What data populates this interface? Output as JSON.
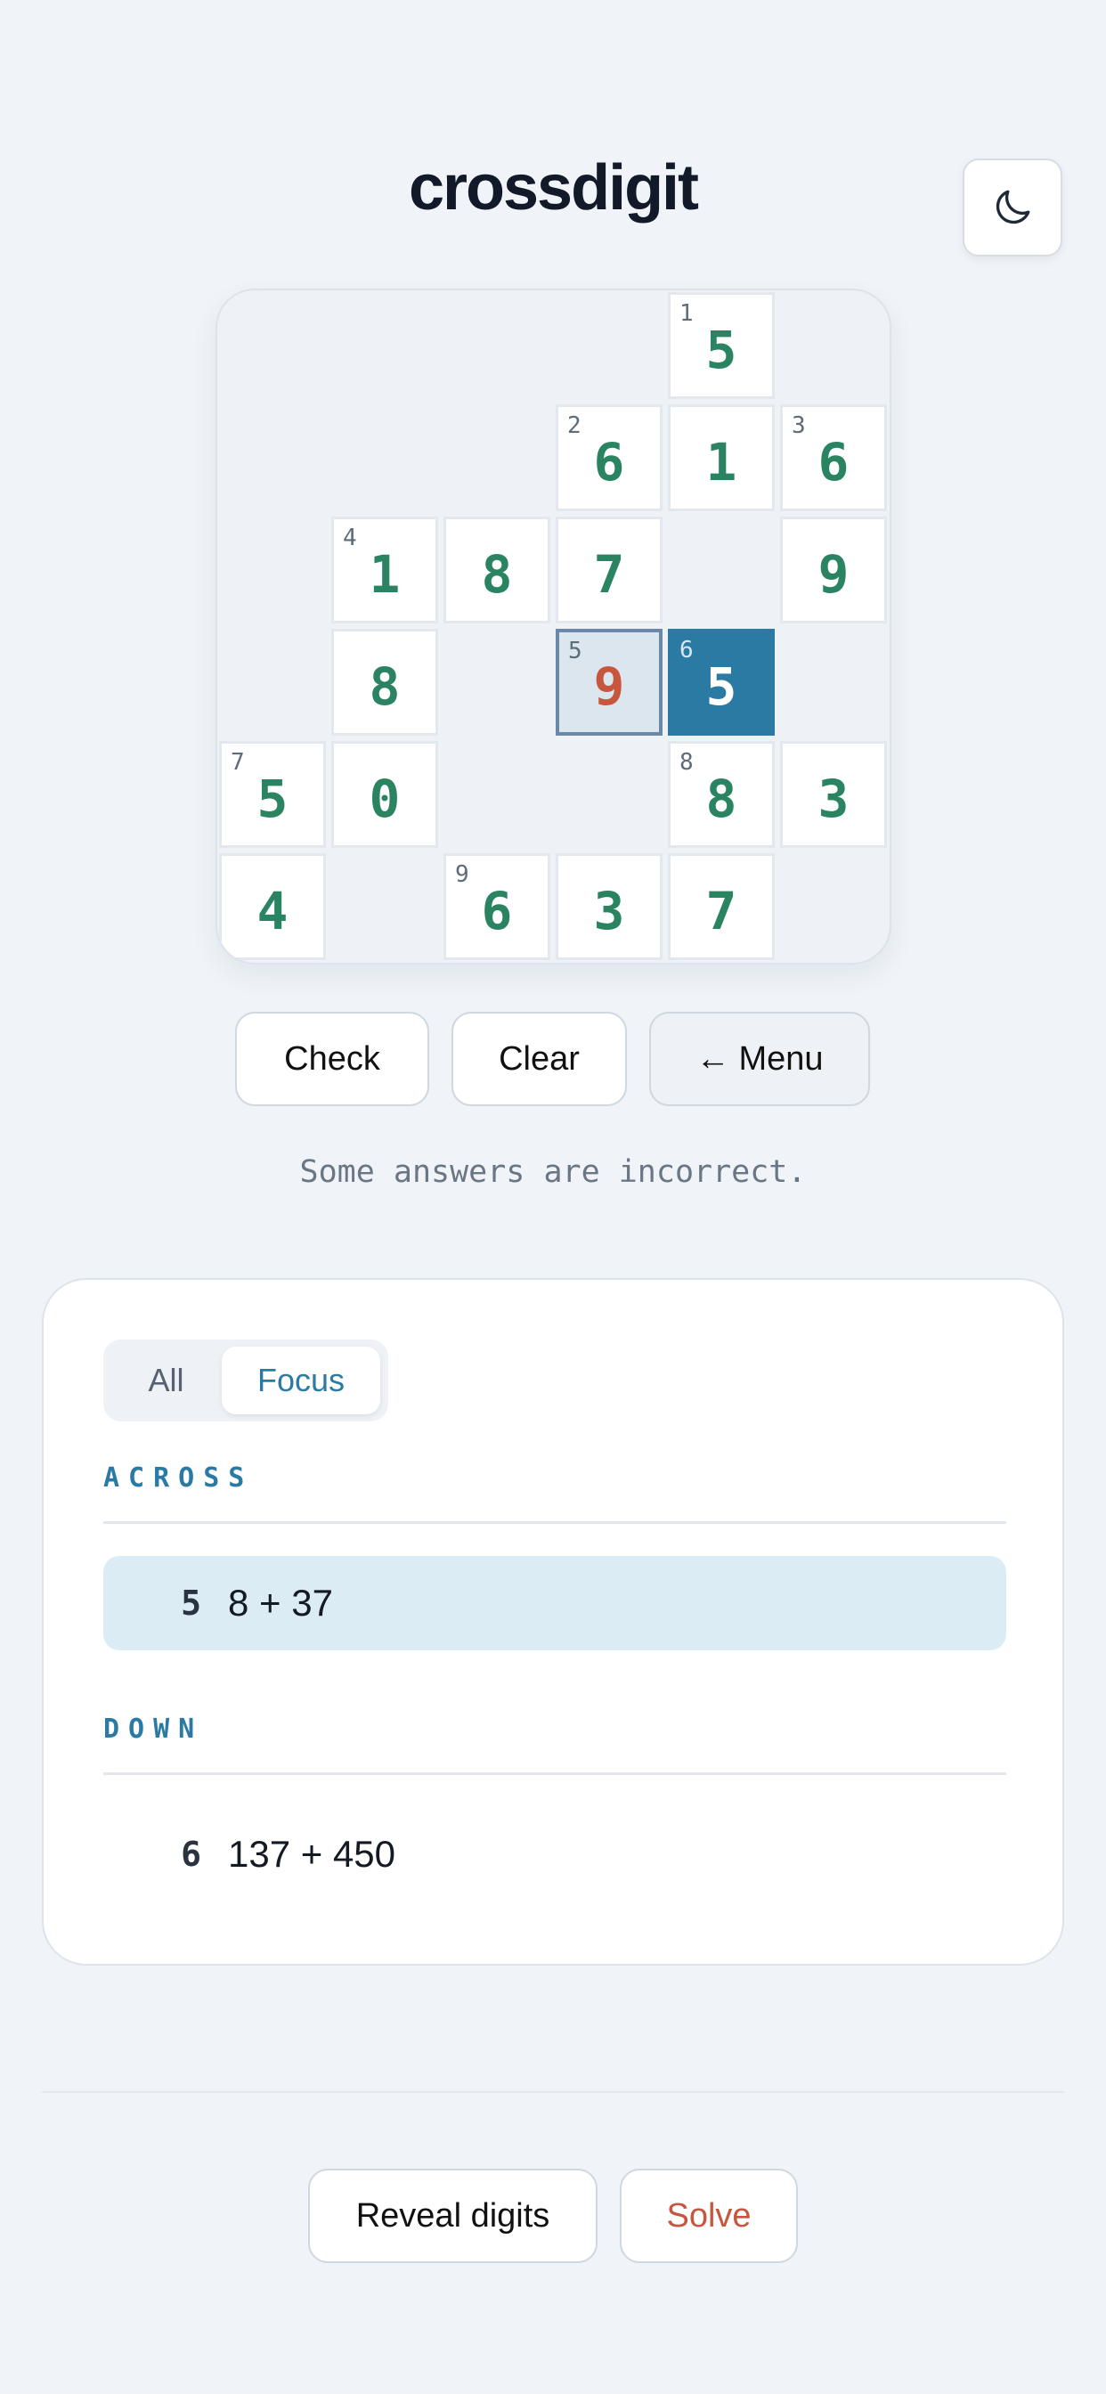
{
  "app": {
    "title": "crossdigit"
  },
  "header": {
    "theme_icon": "moon-icon"
  },
  "board": {
    "cells": [
      {
        "id": "r0c4",
        "row": 0,
        "col": 4,
        "number": "1",
        "digit": "5",
        "state": "normal"
      },
      {
        "id": "r1c3",
        "row": 1,
        "col": 3,
        "number": "2",
        "digit": "6",
        "state": "normal"
      },
      {
        "id": "r1c4",
        "row": 1,
        "col": 4,
        "number": "",
        "digit": "1",
        "state": "normal"
      },
      {
        "id": "r1c5",
        "row": 1,
        "col": 5,
        "number": "3",
        "digit": "6",
        "state": "normal"
      },
      {
        "id": "r2c1",
        "row": 2,
        "col": 1,
        "number": "4",
        "digit": "1",
        "state": "normal"
      },
      {
        "id": "r2c2",
        "row": 2,
        "col": 2,
        "number": "",
        "digit": "8",
        "state": "normal"
      },
      {
        "id": "r2c3",
        "row": 2,
        "col": 3,
        "number": "",
        "digit": "7",
        "state": "normal"
      },
      {
        "id": "r2c5",
        "row": 2,
        "col": 5,
        "number": "",
        "digit": "9",
        "state": "normal"
      },
      {
        "id": "r3c1",
        "row": 3,
        "col": 1,
        "number": "",
        "digit": "8",
        "state": "normal"
      },
      {
        "id": "r3c3",
        "row": 3,
        "col": 3,
        "number": "5",
        "digit": "9",
        "state": "selected"
      },
      {
        "id": "r3c4",
        "row": 3,
        "col": 4,
        "number": "6",
        "digit": "5",
        "state": "focus"
      },
      {
        "id": "r4c0",
        "row": 4,
        "col": 0,
        "number": "7",
        "digit": "5",
        "state": "normal"
      },
      {
        "id": "r4c1",
        "row": 4,
        "col": 1,
        "number": "",
        "digit": "0",
        "state": "normal"
      },
      {
        "id": "r4c4",
        "row": 4,
        "col": 4,
        "number": "8",
        "digit": "8",
        "state": "normal"
      },
      {
        "id": "r4c5",
        "row": 4,
        "col": 5,
        "number": "",
        "digit": "3",
        "state": "normal"
      },
      {
        "id": "r5c0",
        "row": 5,
        "col": 0,
        "number": "",
        "digit": "4",
        "state": "normal"
      },
      {
        "id": "r5c2",
        "row": 5,
        "col": 2,
        "number": "9",
        "digit": "6",
        "state": "normal"
      },
      {
        "id": "r5c3",
        "row": 5,
        "col": 3,
        "number": "",
        "digit": "3",
        "state": "normal"
      },
      {
        "id": "r5c4",
        "row": 5,
        "col": 4,
        "number": "",
        "digit": "7",
        "state": "normal"
      }
    ]
  },
  "controls": {
    "check_label": "Check",
    "clear_label": "Clear",
    "menu_arrow": "←",
    "menu_label": "Menu"
  },
  "status": {
    "message": "Some answers are incorrect."
  },
  "clues_panel": {
    "tabs": {
      "all": "All",
      "focus": "Focus"
    },
    "across_label": "ACROSS",
    "down_label": "DOWN",
    "across": {
      "number": "5",
      "text": "8 + 37"
    },
    "down": {
      "number": "6",
      "text": "137 + 450"
    }
  },
  "footer": {
    "reveal_label": "Reveal digits",
    "solve_label": "Solve"
  },
  "colors": {
    "accent": "#2b7aa4",
    "digit": "#2a8361",
    "error": "#c8553d",
    "background": "#f0f4f8"
  }
}
